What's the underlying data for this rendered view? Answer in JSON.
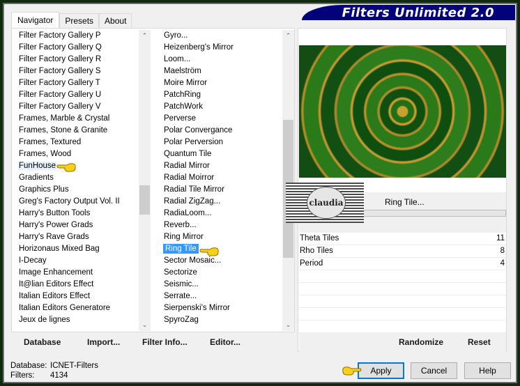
{
  "window": {
    "title": "Filters Unlimited 2.0"
  },
  "tabs": [
    {
      "label": "Navigator",
      "active": true
    },
    {
      "label": "Presets",
      "active": false
    },
    {
      "label": "About",
      "active": false
    }
  ],
  "categories": {
    "items": [
      "Filter Factory Gallery P",
      "Filter Factory Gallery Q",
      "Filter Factory Gallery R",
      "Filter Factory Gallery S",
      "Filter Factory Gallery T",
      "Filter Factory Gallery U",
      "Filter Factory Gallery V",
      "Frames, Marble & Crystal",
      "Frames, Stone & Granite",
      "Frames, Textured",
      "Frames, Wood",
      "FunHouse",
      "Gradients",
      "Graphics Plus",
      "Greg's Factory Output Vol. II",
      "Harry's Button Tools",
      "Harry's Power Grads",
      "Harry's Rave Grads",
      "Horizonaus Mixed Bag",
      "I-Decay",
      "Image Enhancement",
      "It@lian Editors Effect",
      "Italian Editors Effect",
      "Italian Editors Generatore",
      "Jeux de lignes"
    ],
    "selected": "FunHouse"
  },
  "filters": {
    "items": [
      "Gyro...",
      "Heizenberg's Mirror",
      "Loom...",
      "Maelström",
      "Moire Mirror",
      "PatchRing",
      "PatchWork",
      "Perverse",
      "Polar Convergance",
      "Polar Perversion",
      "Quantum Tile",
      "Radial Mirror",
      "Radial Moirror",
      "Radial Tile Mirror",
      "Radial ZigZag...",
      "RadiaLoom...",
      "Reverb...",
      "Ring Mirror",
      "Ring Tile",
      "Sector Mosaic...",
      "Sectorize",
      "Seismic...",
      "Serrate...",
      "Sierpenski's Mirror",
      "SpyroZag"
    ],
    "selected": "Ring Tile"
  },
  "left_buttons": {
    "database": "Database",
    "import": "Import...",
    "filter_info": "Filter Info...",
    "editor": "Editor..."
  },
  "preview": {
    "filter_title": "Ring Tile...",
    "watermark": "claudia"
  },
  "parameters": [
    {
      "name": "Theta Tiles",
      "value": "11"
    },
    {
      "name": "Rho Tiles",
      "value": "8"
    },
    {
      "name": "Period",
      "value": "4"
    }
  ],
  "right_buttons": {
    "randomize": "Randomize",
    "reset": "Reset"
  },
  "status": {
    "database_label": "Database:",
    "database_value": "ICNET-Filters",
    "filters_label": "Filters:",
    "filters_value": "4134"
  },
  "dialog_buttons": {
    "apply": "Apply",
    "cancel": "Cancel",
    "help": "Help"
  },
  "colors": {
    "frame": "#0f2a0f",
    "banner": "#02027a",
    "selection": "#3399ff",
    "default_button_border": "#0078d7"
  }
}
